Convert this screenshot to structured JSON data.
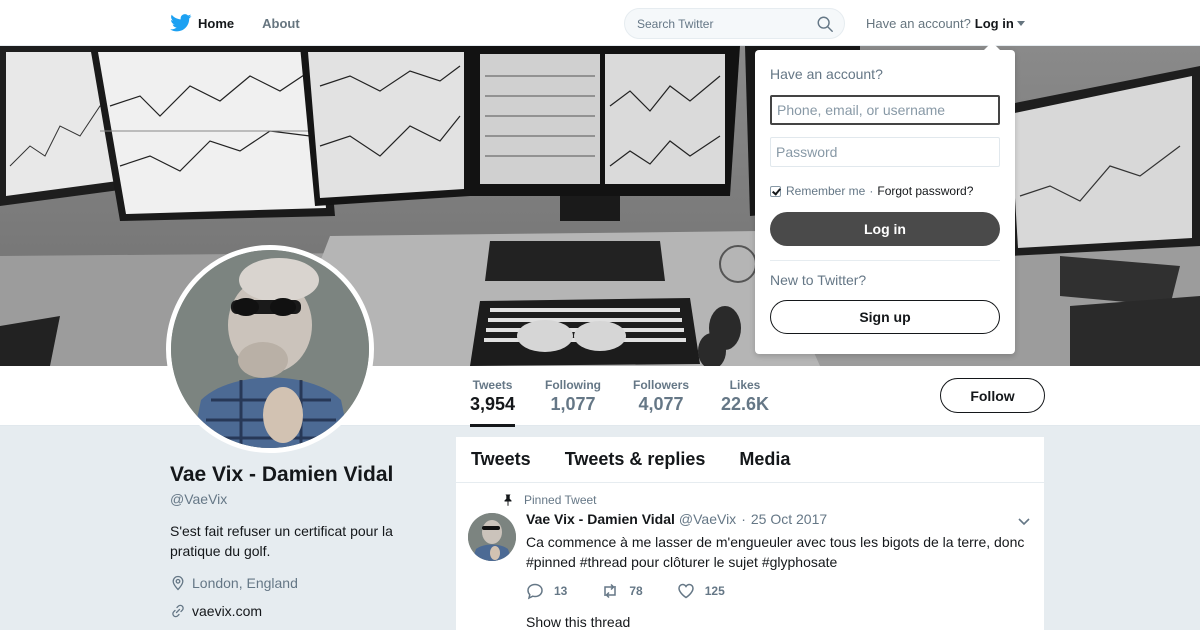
{
  "nav": {
    "home_label": "Home",
    "about_label": "About",
    "search_placeholder": "Search Twitter",
    "have_account": "Have an account?",
    "login_label": "Log in"
  },
  "stats": {
    "tweets_label": "Tweets",
    "tweets_value": "3,954",
    "following_label": "Following",
    "following_value": "1,077",
    "followers_label": "Followers",
    "followers_value": "4,077",
    "likes_label": "Likes",
    "likes_value": "22.6K",
    "follow_button": "Follow"
  },
  "profile": {
    "name": "Vae Vix - Damien Vidal",
    "handle": "@VaeVix",
    "bio": "S'est fait refuser un certificat pour la pratique du golf.",
    "location": "London, England",
    "url": "vaevix.com"
  },
  "timeline": {
    "tabs": [
      "Tweets",
      "Tweets & replies",
      "Media"
    ],
    "pinned_label": "Pinned Tweet",
    "tweet": {
      "author_name": "Vae Vix - Damien Vidal",
      "author_handle": "@VaeVix",
      "separator": "·",
      "date": "25 Oct 2017",
      "text": "Ca commence à me lasser de m'engueuler avec tous les bigots de la terre, donc #pinned #thread pour clôturer le sujet #glyphosate",
      "replies": "13",
      "retweets": "78",
      "likes": "125",
      "show_thread": "Show this thread"
    }
  },
  "login_dropdown": {
    "title": "Have an account?",
    "username_placeholder": "Phone, email, or username",
    "password_placeholder": "Password",
    "remember_me": "Remember me",
    "separator": "·",
    "forgot_password": "Forgot password?",
    "login_button": "Log in",
    "new_to_twitter": "New to Twitter?",
    "signup_button": "Sign up"
  },
  "colors": {
    "text_primary": "#14171a",
    "text_secondary": "#657786",
    "background": "#e6ecf0",
    "brand_blue": "#1da1f2",
    "login_button": "#4a4a4a"
  }
}
